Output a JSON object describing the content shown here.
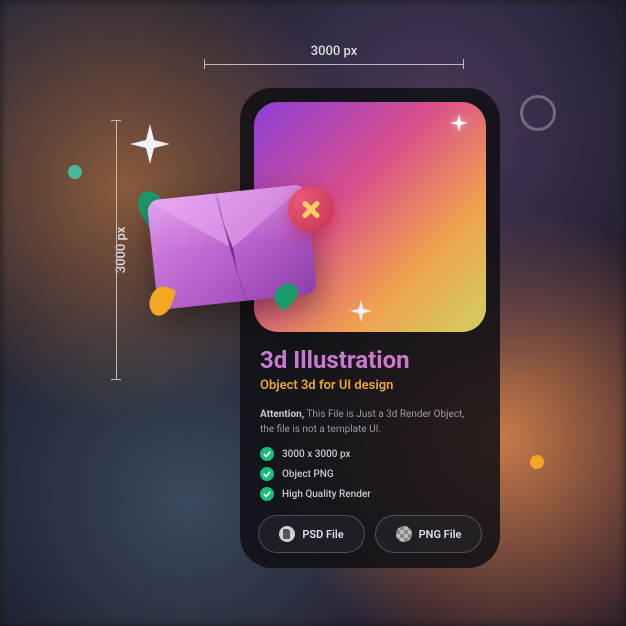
{
  "dimensions": {
    "width": "3000 px",
    "height": "3000 px"
  },
  "card": {
    "title": "3d Illustration",
    "subtitle": "Object 3d for UI design",
    "attention_label": "Attention,",
    "attention_text": "This File is Just a 3d Render Object, the file is not a template UI.",
    "features": [
      "3000 x 3000 px",
      "Object PNG",
      "High Quality Render"
    ],
    "buttons": {
      "psd": "PSD File",
      "png": "PNG File"
    }
  }
}
